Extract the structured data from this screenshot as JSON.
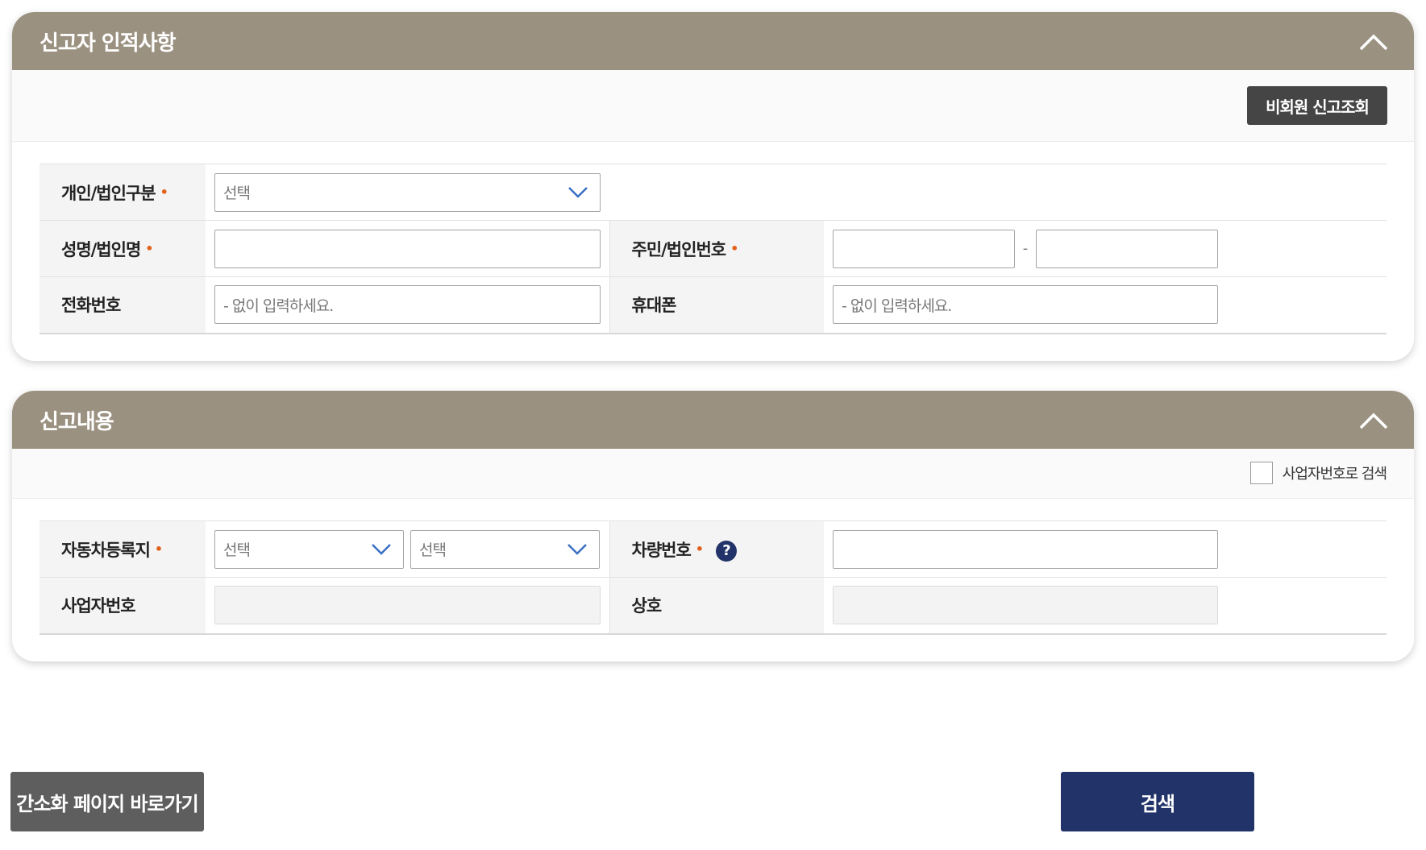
{
  "section1": {
    "title": "신고자 인적사항",
    "lookup_button": "비회원 신고조회",
    "rows": {
      "type_label": "개인/법인구분",
      "type_select": "선택",
      "name_label": "성명/법인명",
      "id_label": "주민/법인번호",
      "id_dash": "-",
      "phone_label": "전화번호",
      "phone_placeholder": "- 없이 입력하세요.",
      "mobile_label": "휴대폰",
      "mobile_placeholder": "- 없이 입력하세요."
    },
    "required_mark": "•"
  },
  "section2": {
    "title": "신고내용",
    "checkbox_label": "사업자번호로 검색",
    "rows": {
      "region_label": "자동차등록지",
      "region_select1": "선택",
      "region_select2": "선택",
      "plate_label": "차량번호",
      "help_icon": "?",
      "biz_label": "사업자번호",
      "company_label": "상호"
    },
    "required_mark": "•"
  },
  "footer": {
    "simple_button": "간소화 페이지 바로가기",
    "search_button": "검색"
  },
  "colors": {
    "header": "#9b9180",
    "required": "#e2621b",
    "dark_button": "#454545",
    "search_button": "#213368"
  }
}
